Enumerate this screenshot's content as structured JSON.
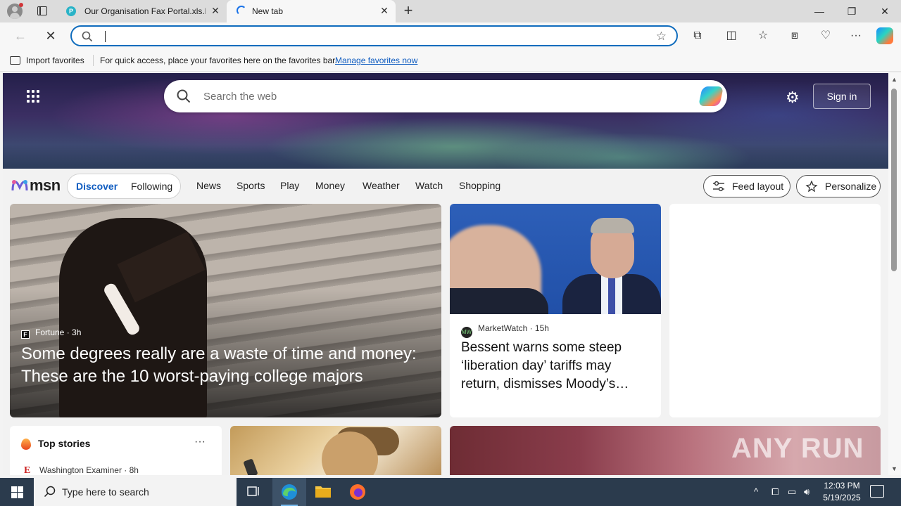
{
  "browser": {
    "tabs": [
      {
        "title": "Our Organisation Fax Portal.xls.h",
        "favicon": "P",
        "active": false
      },
      {
        "title": "New tab",
        "active": true
      }
    ],
    "window_controls": {
      "minimize": "—",
      "restore": "❐",
      "close": "✕"
    },
    "address": {
      "value": "",
      "placeholder": ""
    },
    "favorites_bar": {
      "import_label": "Import favorites",
      "hint": "For quick access, place your favorites here on the favorites bar.",
      "manage_link": "Manage favorites now"
    }
  },
  "msn": {
    "search_placeholder": "Search the web",
    "sign_in": "Sign in",
    "logo_text": "msn",
    "feed_tabs": [
      "Discover",
      "Following"
    ],
    "nav": [
      "News",
      "Sports",
      "Play",
      "Money",
      "Weather",
      "Watch",
      "Shopping"
    ],
    "feed_layout": "Feed layout",
    "personalize": "Personalize"
  },
  "cards": {
    "lead": {
      "source": "Fortune",
      "source_icon": "F",
      "age": "3h",
      "headline": "Some degrees really are a waste of time and money: These are the 10 worst-paying college majors"
    },
    "second": {
      "source": "MarketWatch",
      "source_icon": "MW",
      "age": "15h",
      "headline": "Bessent warns some steep ‘liberation day’ tariffs may return, dismisses Moody’s…"
    },
    "top_stories": {
      "title": "Top stories",
      "source": "Washington Examiner",
      "source_icon": "E",
      "age": "8h"
    }
  },
  "watermark": "ANY RUN",
  "taskbar": {
    "search_placeholder": "Type here to search",
    "time": "12:03 PM",
    "date": "5/19/2025"
  },
  "colors": {
    "accent": "#0f6cbd",
    "taskbar": "#2b3b4d",
    "link": "#0f5cc0"
  }
}
